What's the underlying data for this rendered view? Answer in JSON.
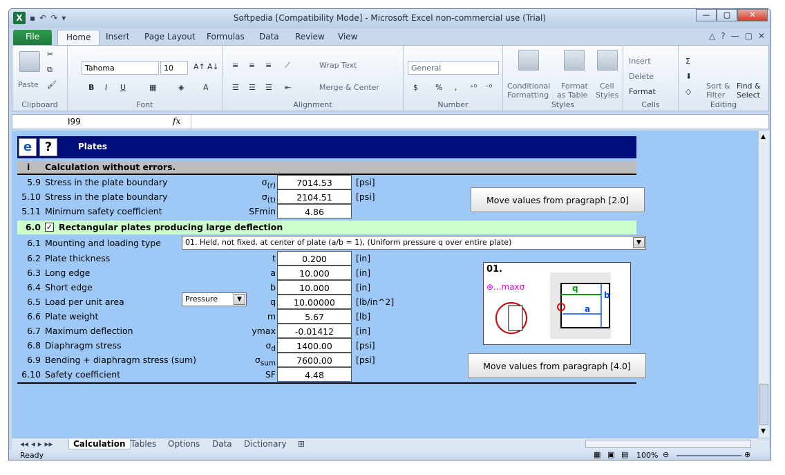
{
  "window": {
    "title": "Softpedia  [Compatibility Mode]  -  Microsoft Excel non-commercial use (Trial)"
  },
  "ribbon_tabs": [
    "File",
    "Home",
    "Insert",
    "Page Layout",
    "Formulas",
    "Data",
    "Review",
    "View"
  ],
  "ribbon": {
    "clipboard": {
      "label": "Clipboard",
      "paste": "Paste"
    },
    "font": {
      "label": "Font",
      "name": "Tahoma",
      "size": "10",
      "bold": "B",
      "italic": "I",
      "underline": "U"
    },
    "alignment": {
      "label": "Alignment",
      "wrap": "Wrap Text",
      "merge": "Merge & Center"
    },
    "number": {
      "label": "Number",
      "format": "General",
      "currency": "$",
      "percent": "%",
      "comma": ","
    },
    "styles": {
      "label": "Styles",
      "conditional": "Conditional",
      "formatting": "Formatting",
      "format": "Format",
      "as_table": "as Table",
      "cell": "Cell",
      "cell_styles": "Styles"
    },
    "cells": {
      "label": "Cells",
      "insert": "Insert",
      "delete": "Delete",
      "format": "Format"
    },
    "editing": {
      "label": "Editing",
      "sigma": "Σ",
      "sort": "Sort &",
      "filter": "Filter",
      "find": "Find &",
      "select": "Select"
    }
  },
  "formula_bar": {
    "cell_ref": "I99",
    "fx": "fx"
  },
  "sheet": {
    "header_title": "Plates",
    "status_i": "i",
    "status_msg": "Calculation without errors.",
    "rows_top": [
      {
        "num": "5.9",
        "label": "Stress in the plate boundary",
        "sym": "σ",
        "sub": "(r)",
        "value": "7014.53",
        "unit": "[psi]"
      },
      {
        "num": "5.10",
        "label": "Stress in the plate boundary",
        "sym": "σ",
        "sub": "(t)",
        "value": "2104.51",
        "unit": "[psi]"
      },
      {
        "num": "5.11",
        "label": "Minimum safety coefficient",
        "sym": "SFmin",
        "sub": "",
        "value": "4.86",
        "unit": ""
      }
    ],
    "btn_top": "Move values from pragraph [2.0]",
    "section_num": "6.0",
    "section_title": "Rectangular plates producing large deflection",
    "checkbox": "✓",
    "mounting_num": "6.1",
    "mounting_label": "Mounting and loading type",
    "mounting_value": "01. Held, not fixed, at center of plate  (a/b = 1), (Uniform pressure q over entire plate)",
    "load_type": "Pressure",
    "rows_bottom": [
      {
        "num": "6.2",
        "label": "Plate thickness",
        "sym": "t",
        "sub": "",
        "value": "0.200",
        "unit": "[in]"
      },
      {
        "num": "6.3",
        "label": "Long edge",
        "sym": "a",
        "sub": "",
        "value": "10.000",
        "unit": "[in]"
      },
      {
        "num": "6.4",
        "label": "Short edge",
        "sym": "b",
        "sub": "",
        "value": "10.000",
        "unit": "[in]"
      },
      {
        "num": "6.5",
        "label": "Load per unit area",
        "sym": "q",
        "sub": "",
        "value": "10.00000",
        "unit": "[lb/in^2]"
      },
      {
        "num": "6.6",
        "label": "Plate weight",
        "sym": "m",
        "sub": "",
        "value": "5.67",
        "unit": "[lb]"
      },
      {
        "num": "6.7",
        "label": "Maximum deflection",
        "sym": "ymax",
        "sub": "",
        "value": "-0.01412",
        "unit": "[in]"
      },
      {
        "num": "6.8",
        "label": "Diaphragm stress",
        "sym": "σ",
        "sub": "d",
        "value": "1400.00",
        "unit": "[psi]"
      },
      {
        "num": "6.9",
        "label": "Bending + diaphragm stress (sum)",
        "sym": "σ",
        "sub": "sum",
        "value": "7600.00",
        "unit": "[psi]"
      },
      {
        "num": "6.10",
        "label": "Safety coefficient",
        "sym": "SF",
        "sub": "",
        "value": "4.48",
        "unit": ""
      }
    ],
    "figure": {
      "label": "01.",
      "max_label": "...maxσ",
      "q": "q",
      "a": "a",
      "b": "b"
    },
    "btn_bottom": "Move values from paragraph [4.0]"
  },
  "sheet_tabs": [
    "Calculation",
    "Tables",
    "Options",
    "Data",
    "Dictionary"
  ],
  "status": {
    "ready": "Ready",
    "zoom": "100%"
  },
  "colors": {
    "header": "#000e7a",
    "sheet_bg": "#9ec8f6",
    "section": "#ccffcc",
    "status_row": "#bdbdbd"
  }
}
